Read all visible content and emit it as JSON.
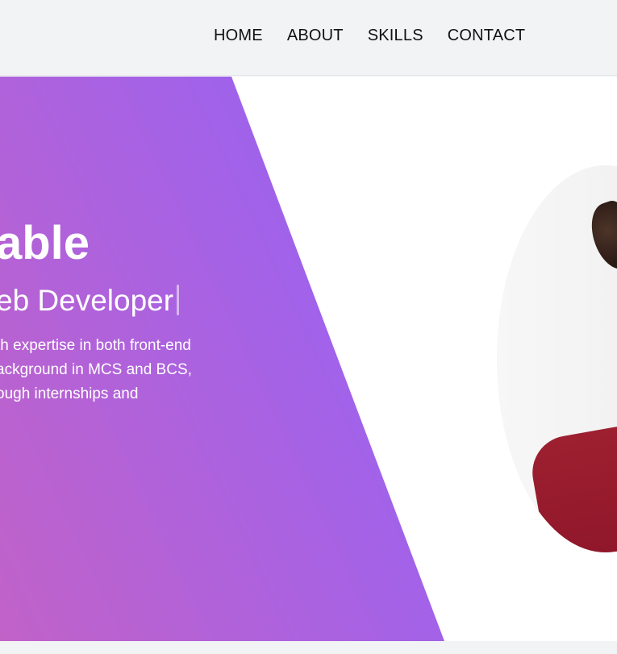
{
  "nav": {
    "items": [
      {
        "label": "HOME"
      },
      {
        "label": "ABOUT"
      },
      {
        "label": "SKILLS"
      },
      {
        "label": "CONTACT"
      }
    ]
  },
  "hero": {
    "name": "able",
    "role": "eb Developer",
    "description": [
      "th expertise in both front-end",
      "ackground in MCS and BCS,",
      "ough internships and"
    ]
  },
  "theme": {
    "background": "#f1f3f5",
    "gradient_start": "#c162c8",
    "gradient_end": "#8f5cfc",
    "text_primary": "#111111",
    "text_inverse": "#ffffff"
  },
  "icons": {
    "profile": "portrait-photo"
  }
}
